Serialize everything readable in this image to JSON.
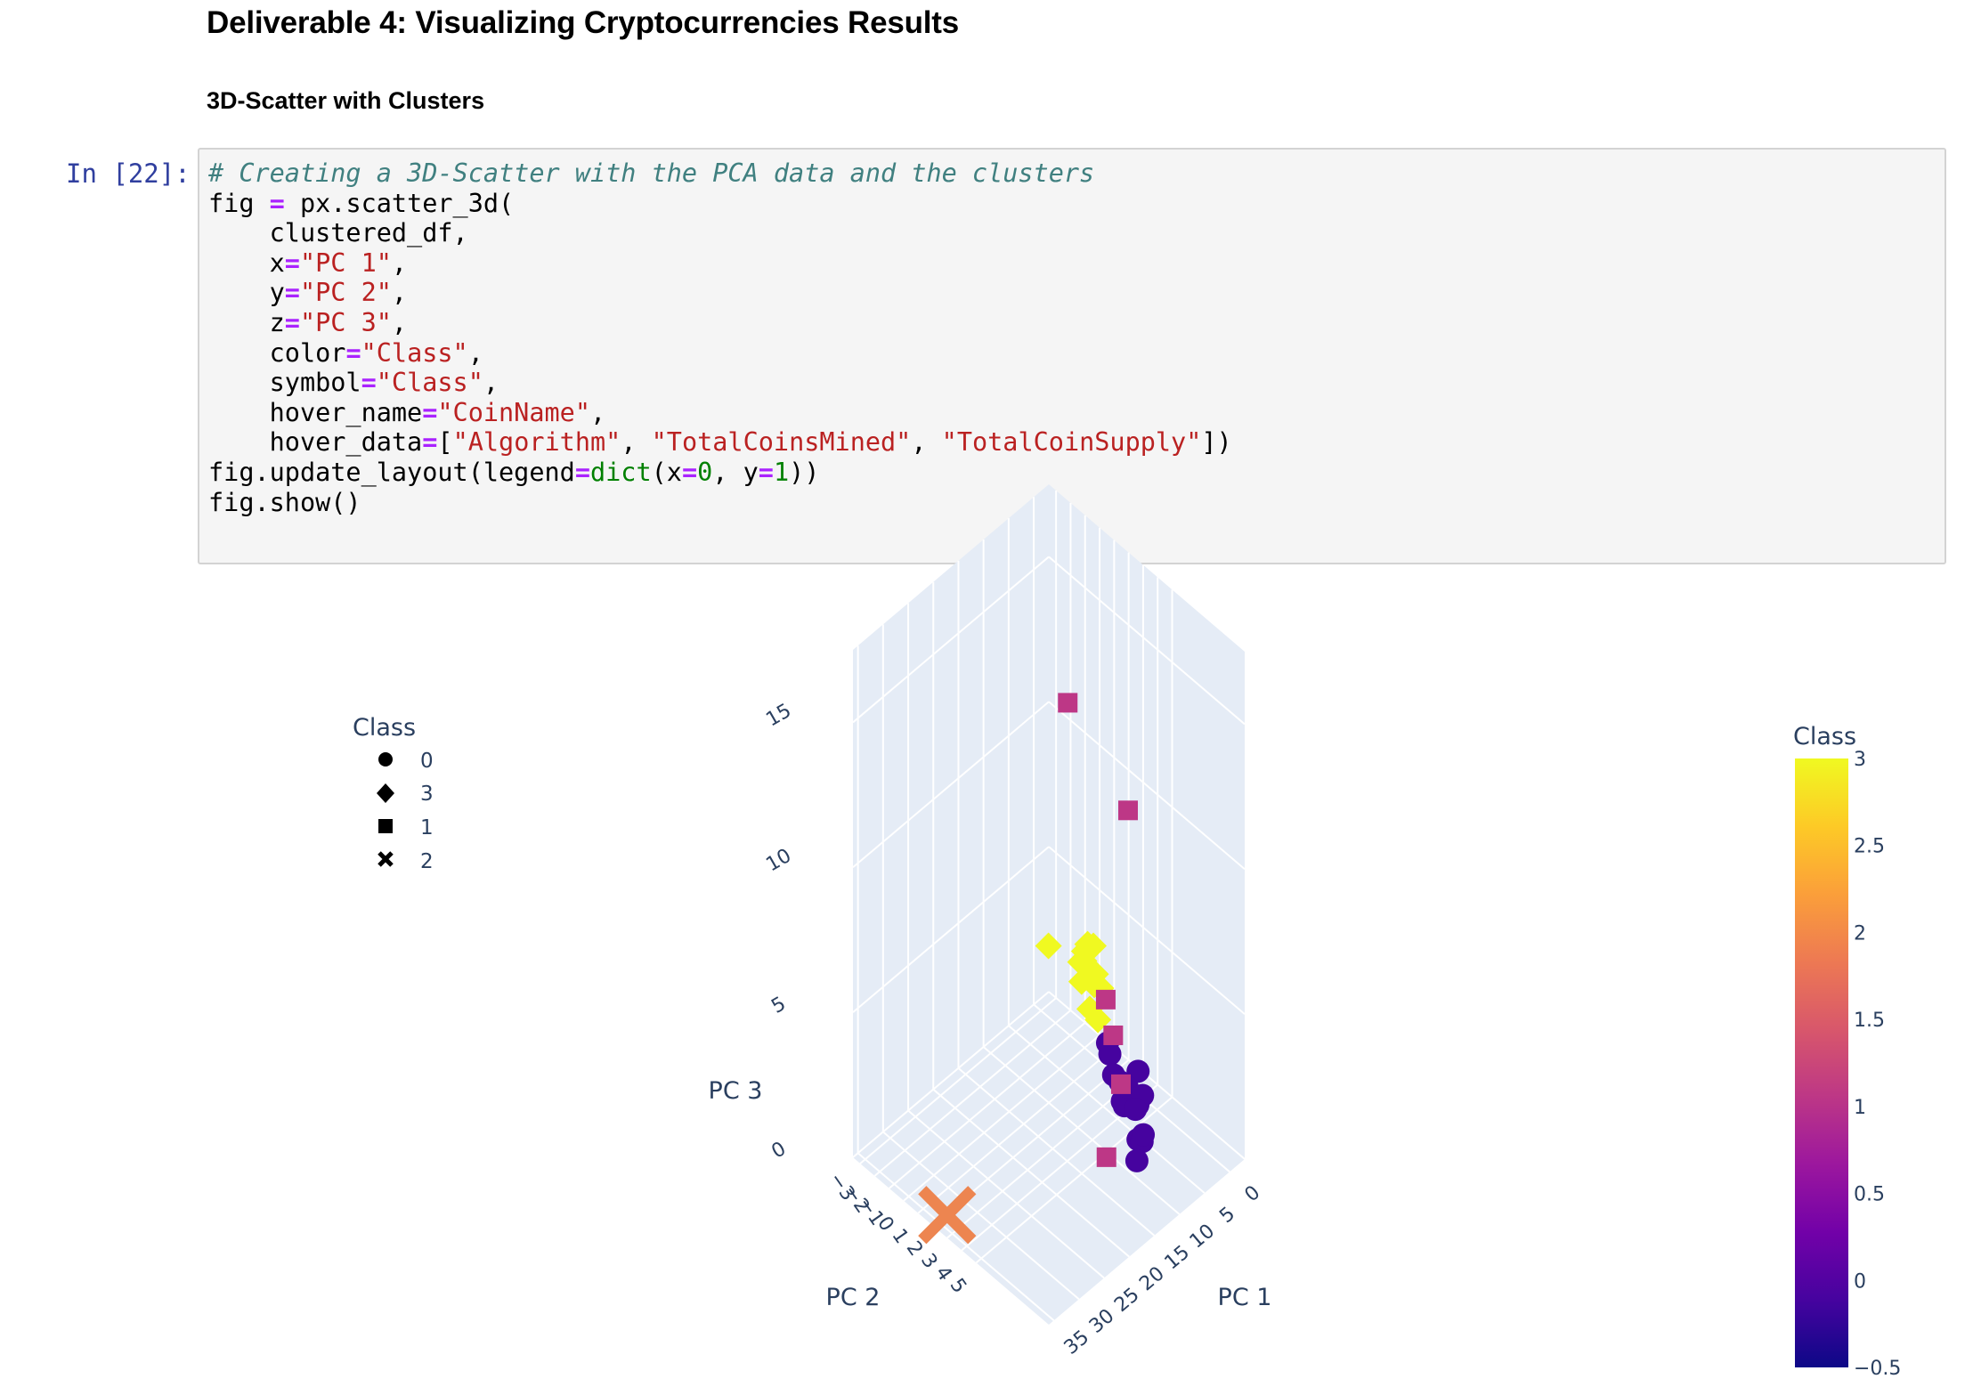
{
  "heading": "Deliverable 4: Visualizing Cryptocurrencies Results",
  "subheading": "3D-Scatter with Clusters",
  "cell": {
    "prompt": "In [22]:",
    "code_lines": [
      [
        [
          "cm",
          "# Creating a 3D-Scatter with the PCA data and the clusters"
        ]
      ],
      [
        [
          "",
          "fig "
        ],
        [
          "op",
          "="
        ],
        [
          "",
          " px.scatter_3d("
        ]
      ],
      [
        [
          "",
          "    clustered_df,"
        ]
      ],
      [
        [
          "",
          "    x"
        ],
        [
          "op",
          "="
        ],
        [
          "st",
          "\"PC 1\""
        ],
        [
          "",
          ","
        ]
      ],
      [
        [
          "",
          "    y"
        ],
        [
          "op",
          "="
        ],
        [
          "st",
          "\"PC 2\""
        ],
        [
          "",
          ","
        ]
      ],
      [
        [
          "",
          "    z"
        ],
        [
          "op",
          "="
        ],
        [
          "st",
          "\"PC 3\""
        ],
        [
          "",
          ","
        ]
      ],
      [
        [
          "",
          "    color"
        ],
        [
          "op",
          "="
        ],
        [
          "st",
          "\"Class\""
        ],
        [
          "",
          ","
        ]
      ],
      [
        [
          "",
          "    symbol"
        ],
        [
          "op",
          "="
        ],
        [
          "st",
          "\"Class\""
        ],
        [
          "",
          ","
        ]
      ],
      [
        [
          "",
          "    hover_name"
        ],
        [
          "op",
          "="
        ],
        [
          "st",
          "\"CoinName\""
        ],
        [
          "",
          ","
        ]
      ],
      [
        [
          "",
          "    hover_data"
        ],
        [
          "op",
          "="
        ],
        [
          "",
          "["
        ],
        [
          "st",
          "\"Algorithm\""
        ],
        [
          "",
          ", "
        ],
        [
          "st",
          "\"TotalCoinsMined\""
        ],
        [
          "",
          ", "
        ],
        [
          "st",
          "\"TotalCoinSupply\""
        ],
        [
          "",
          "])"
        ]
      ],
      [
        [
          "",
          "fig.update_layout(legend"
        ],
        [
          "op",
          "="
        ],
        [
          "bi",
          "dict"
        ],
        [
          "",
          "(x"
        ],
        [
          "op",
          "="
        ],
        [
          "nu",
          "0"
        ],
        [
          "",
          ", y"
        ],
        [
          "op",
          "="
        ],
        [
          "nu",
          "1"
        ],
        [
          "",
          "))"
        ]
      ],
      [
        [
          "",
          "fig.show()"
        ]
      ]
    ]
  },
  "legend": {
    "title": "Class",
    "items": [
      {
        "label": "0",
        "symbol": "circle"
      },
      {
        "label": "3",
        "symbol": "diamond"
      },
      {
        "label": "1",
        "symbol": "square"
      },
      {
        "label": "2",
        "symbol": "x"
      }
    ]
  },
  "colorbar": {
    "title": "Class",
    "tick_labels": [
      "3",
      "2.5",
      "2",
      "1.5",
      "1",
      "0.5",
      "0",
      "−0.5"
    ],
    "colors": [
      "#f0f921",
      "#fdca26",
      "#fb9f3a",
      "#ed7953",
      "#d8576b",
      "#bd3786",
      "#9c179e",
      "#7201a8",
      "#46039f",
      "#0d0887"
    ],
    "range": [
      -0.5,
      3
    ]
  },
  "chart_data": {
    "type": "scatter",
    "projection": "3d",
    "axes": {
      "x": {
        "label": "PC 1",
        "ticks": [
          "0",
          "5",
          "10",
          "15",
          "20",
          "25",
          "30",
          "35"
        ]
      },
      "y": {
        "label": "PC 2",
        "ticks": [
          "−3",
          "−2",
          "−1",
          "0",
          "1",
          "2",
          "3",
          "4",
          "5"
        ]
      },
      "z": {
        "label": "PC 3",
        "ticks": [
          "0",
          "5",
          "10",
          "15"
        ]
      }
    },
    "series": [
      {
        "name": "0",
        "symbol": "circle",
        "color": "#46039f",
        "points": [
          [
            1.2,
            2.0,
            1.2
          ],
          [
            1.6,
            2.3,
            1.0
          ],
          [
            2.3,
            2.8,
            0.6
          ],
          [
            2.8,
            3.4,
            0.7
          ],
          [
            3.3,
            3.7,
            0.8
          ],
          [
            4.5,
            4.3,
            0.5
          ],
          [
            5.2,
            4.4,
            0.8
          ],
          [
            4.4,
            5.2,
            0.9
          ],
          [
            5.8,
            5.9,
            0.2
          ],
          [
            6.4,
            5.9,
            0.3
          ],
          [
            6.8,
            6.3,
            0.5
          ],
          [
            7.6,
            6.6,
            0.7
          ],
          [
            9.4,
            7.3,
            1.5
          ],
          [
            12.4,
            7.9,
            1.3
          ],
          [
            3.5,
            4.9,
            1.8
          ],
          [
            5.4,
            4.8,
            1.5
          ],
          [
            5.2,
            5.8,
            1.6
          ],
          [
            7.2,
            6.0,
            1.5
          ]
        ]
      },
      {
        "name": "3",
        "symbol": "diamond",
        "color": "#f0f921",
        "points": [
          [
            -1.5,
            -0.8,
            2.4
          ],
          [
            -1.1,
            -0.4,
            3.0
          ],
          [
            -0.9,
            -0.1,
            3.4
          ],
          [
            -0.6,
            0.4,
            3.6
          ],
          [
            -0.2,
            0.6,
            2.4
          ],
          [
            0.1,
            0.8,
            2.9
          ],
          [
            -0.3,
            0.0,
            2.8
          ],
          [
            0.0,
            -0.2,
            2.2
          ],
          [
            0.2,
            1.2,
            2.6
          ],
          [
            0.7,
            0.6,
            1.7
          ],
          [
            0.8,
            1.2,
            1.6
          ],
          [
            -1.2,
            -2.9,
            2.1
          ],
          [
            0.4,
            0.1,
            3.1
          ]
        ]
      },
      {
        "name": "1",
        "symbol": "square",
        "color": "#bd3786",
        "points": [
          [
            -0.7,
            -1.4,
            11.2
          ],
          [
            13.0,
            7.5,
            13.3
          ],
          [
            17.6,
            8.6,
            5.0
          ],
          [
            17.4,
            8.0,
            6.4
          ],
          [
            16.0,
            7.0,
            7.0
          ],
          [
            22.5,
            9.3,
            3.5
          ]
        ]
      },
      {
        "name": "2",
        "symbol": "x",
        "color": "#ed8550",
        "points": [
          [
            34.0,
            2.3,
            0.2
          ]
        ]
      }
    ]
  }
}
